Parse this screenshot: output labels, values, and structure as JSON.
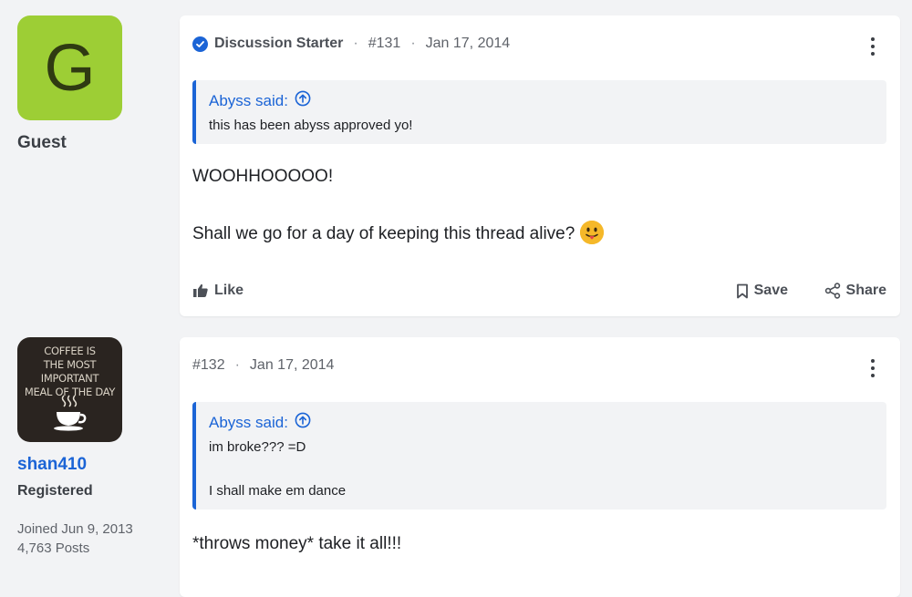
{
  "post1": {
    "user": {
      "avatar_letter": "G",
      "avatar_color": "#9dce35",
      "name": "Guest"
    },
    "badge": "Discussion Starter",
    "number": "#131",
    "date": "Jan 17, 2014",
    "quote": {
      "author": "Abyss said:",
      "lines": [
        "this has been abyss approved yo!"
      ]
    },
    "body": [
      "WOOHHOOOOO!",
      "Shall we go for a day of keeping this thread alive?"
    ],
    "emoji": "tongue-out-emoji",
    "actions": {
      "like": "Like",
      "save": "Save",
      "share": "Share"
    }
  },
  "post2": {
    "user": {
      "avatar_text": [
        "COFFEE IS",
        "THE MOST IMPORTANT",
        "MEAL OF THE DAY"
      ],
      "name": "shan410",
      "role": "Registered",
      "joined": "Joined Jun 9, 2013",
      "posts": "4,763 Posts"
    },
    "number": "#132",
    "date": "Jan 17, 2014",
    "quote": {
      "author": "Abyss said:",
      "lines": [
        "im broke??? =D",
        "I shall make em dance"
      ]
    },
    "body": [
      "*throws money* take it all!!!"
    ]
  },
  "colors": {
    "accent": "#1b64d6",
    "background": "#f2f3f5",
    "card": "#ffffff"
  }
}
